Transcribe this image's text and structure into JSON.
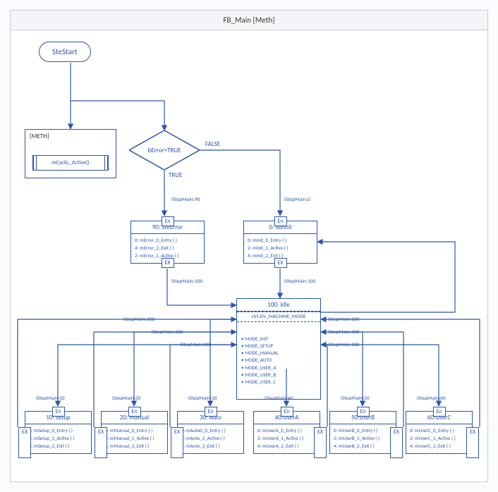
{
  "title": "FB_Main [Meth]",
  "start": "SteStart",
  "method_container": {
    "tag": "[METH]",
    "call": "mCyclic_Active()"
  },
  "decision": {
    "cond": "bError=TRUE",
    "true_label": "TRUE",
    "false_label": "FALSE"
  },
  "tags": {
    "entry": "En",
    "exit": "EX"
  },
  "edge_labels": {
    "to_error": "iStepMain:90",
    "to_init": "iStepMain:0",
    "error_to_idle": "iStepMain:100",
    "init_to_idle": "iStepMain:100",
    "idle_to_setup": "iStepMain:10",
    "idle_to_manual": "iStepMain:20",
    "idle_to_auto": "iStepMain:30",
    "idle_to_usera": "iStepMain:40",
    "idle_to_userb": "iStepMain:50",
    "idle_to_userc": "iStepMain:60",
    "back_to_idle": "iStepMain:100"
  },
  "states": {
    "error": {
      "title": "90: SteError",
      "lines": [
        "0: mError_0_Entry ( )",
        "4: mError_2_Exit ( )",
        "2: mError_1_Active ( )"
      ]
    },
    "init": {
      "title": "0: SteInit",
      "lines": [
        "0: mInit_0_Entry ( )",
        "2: mInit_1_Active ( )",
        "4: mInit_2_Exit ( )"
      ]
    },
    "idle": {
      "title": "100: Idle",
      "subtitle": "ctrl.EN_MACHINE_MODE",
      "modes": [
        "MODE_INIT",
        "MODE_SETUP",
        "MODE_MANUAL",
        "MODE_AUTO",
        "MODE_USER_A",
        "MODE_USER_B",
        "MODE_USER_C"
      ]
    },
    "setup": {
      "title": "10: Setup",
      "lines": [
        "0: mSetup_0_Entry ( )",
        "2: mSetup_1_Active ( )",
        "4: mSetup_2_Exit ( )"
      ]
    },
    "manual": {
      "title": "20: Manual",
      "lines": [
        "0: mManual_0_Entry ( )",
        "2: mManual_1_Active ( )",
        "4: mManual_2_Exit ( )"
      ]
    },
    "auto": {
      "title": "30: Auto",
      "lines": [
        "0: mAuto0_0_Entry ( )",
        "2: mAuto_1_Active ( )",
        "4: mAuto_2_Exit ( )"
      ]
    },
    "usera": {
      "title": "40:UserA",
      "lines": [
        "0: mUserA_0_Entry ( )",
        "2: mUserA_1_Active ( )",
        "4: mUserA_2_Exit ( )"
      ]
    },
    "userb": {
      "title": "50:UserB",
      "lines": [
        "0: mUserB_0_Entry ( )",
        "2: mUserB_1_Active ( )",
        "4: mUserB_2_Exit ( )"
      ]
    },
    "userc": {
      "title": "60:UserC",
      "lines": [
        "0: mUserC_0_Entry ( )",
        "2: mUserC_1_Active ( )",
        "4: mUserC_2_Exit ( )"
      ]
    }
  }
}
